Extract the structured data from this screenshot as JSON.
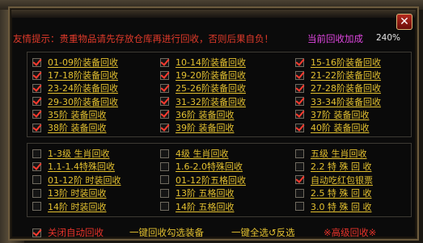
{
  "window": {
    "close_label": "✕"
  },
  "notice": "友情提示：贵重物品请先存放仓库再进行回收，否则后果自负！",
  "bonus": {
    "label": "当前回收加成",
    "value": "240%"
  },
  "groups": {
    "top": [
      {
        "label": "01-09阶装备回收",
        "checked": true
      },
      {
        "label": "10-14阶装备回收",
        "checked": true
      },
      {
        "label": "15-16阶装备回收",
        "checked": true
      },
      {
        "label": "17-18阶装备回收",
        "checked": true
      },
      {
        "label": "19-20阶装备回收",
        "checked": true
      },
      {
        "label": "21-22阶装备回收",
        "checked": true
      },
      {
        "label": "23-24阶装备回收",
        "checked": true
      },
      {
        "label": "25-26阶装备回收",
        "checked": true
      },
      {
        "label": "27-28阶装备回收",
        "checked": true
      },
      {
        "label": "29-30阶装备回收",
        "checked": true
      },
      {
        "label": "31-32阶装备回收",
        "checked": true
      },
      {
        "label": "33-34阶装备回收",
        "checked": true
      },
      {
        "label": "35阶    装备回收",
        "checked": true
      },
      {
        "label": "36阶    装备回收",
        "checked": true
      },
      {
        "label": "37阶    装备回收",
        "checked": true
      },
      {
        "label": "38阶    装备回收",
        "checked": true
      },
      {
        "label": "39阶    装备回收",
        "checked": true
      },
      {
        "label": "40阶    装备回收",
        "checked": true
      }
    ],
    "bottom": [
      {
        "label": "1-3级  生肖回收",
        "checked": false
      },
      {
        "label": "4级    生肖回收",
        "checked": false
      },
      {
        "label": "五级     生肖回收",
        "checked": false
      },
      {
        "label": "1.1-1.4特殊回收",
        "checked": true
      },
      {
        "label": "1.6-2.0特殊回收",
        "checked": false
      },
      {
        "label": "2.2 特 殊 回 收",
        "checked": false
      },
      {
        "label": "01-12阶 时装回收",
        "checked": false
      },
      {
        "label": "01-12阶五格回收",
        "checked": false
      },
      {
        "label": "自动吃红包银票",
        "checked": true
      },
      {
        "label": "13阶    时装回收",
        "checked": false
      },
      {
        "label": "13阶    五格回收",
        "checked": false
      },
      {
        "label": "2.5 特 殊 回 收",
        "checked": false
      },
      {
        "label": "14阶    时装回收",
        "checked": false
      },
      {
        "label": "14阶    五格回收",
        "checked": false
      },
      {
        "label": "3.0 特 殊 回 收",
        "checked": false
      }
    ]
  },
  "footer": {
    "auto_close": {
      "label": "关闭自动回收",
      "checked": true
    },
    "one_click": "一键回收勾选装备",
    "select_all": "一键全选↺反选",
    "advanced": "※高级回收※"
  }
}
